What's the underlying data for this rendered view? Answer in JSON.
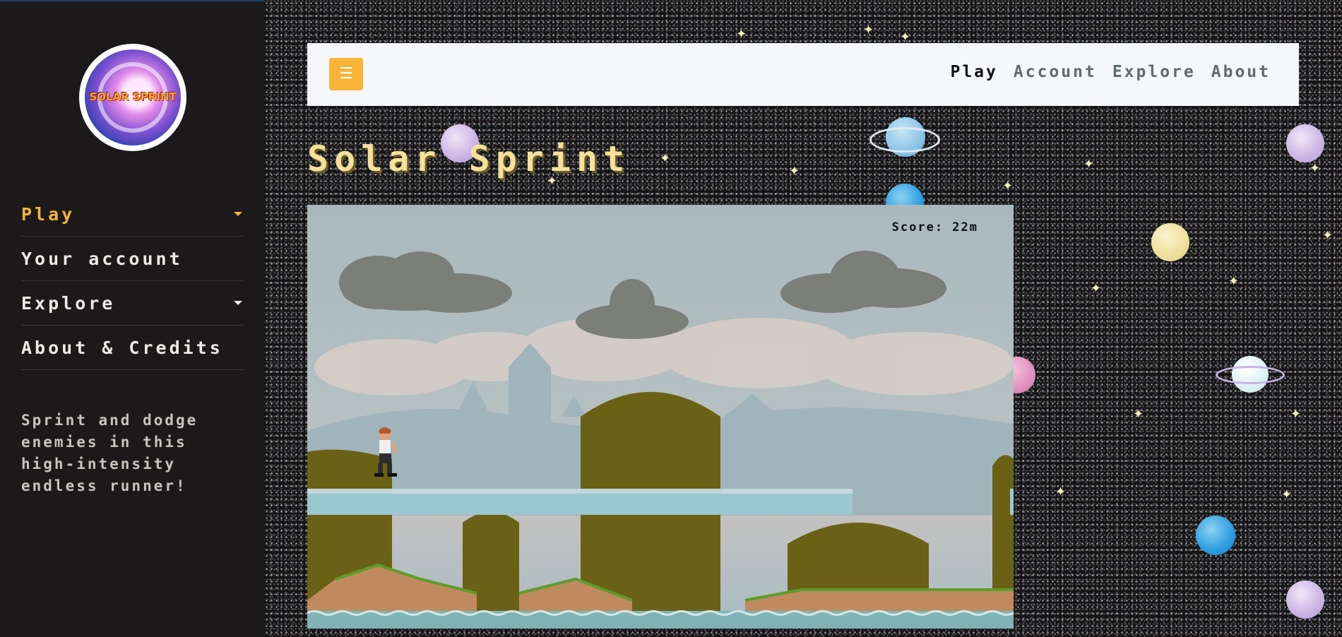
{
  "logo": {
    "text": "SOLAR SPRINT"
  },
  "sidebar": {
    "items": [
      {
        "label": "Play",
        "has_caret": true,
        "active": true
      },
      {
        "label": "Your account",
        "has_caret": false,
        "active": false
      },
      {
        "label": "Explore",
        "has_caret": true,
        "active": false
      },
      {
        "label": "About & Credits",
        "has_caret": false,
        "active": false
      }
    ],
    "tagline": "Sprint and dodge enemies in this high-intensity endless runner!"
  },
  "topbar": {
    "menu_icon": "hamburger-icon",
    "links": [
      {
        "label": "Play",
        "active": true
      },
      {
        "label": "Account",
        "active": false
      },
      {
        "label": "Explore",
        "active": false
      },
      {
        "label": "About",
        "active": false
      }
    ]
  },
  "page": {
    "title": "Solar Sprint"
  },
  "game": {
    "score": "Score: 22m"
  },
  "colors": {
    "accent": "#f7b436",
    "sidebar_bg": "#1b1919",
    "title": "#f5e19a",
    "topbar_bg": "#f5f7fa"
  }
}
